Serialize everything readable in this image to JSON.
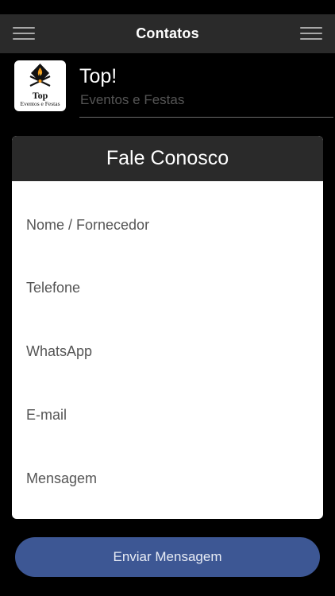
{
  "navbar": {
    "title": "Contatos",
    "left_icon": "hamburger-menu-icon",
    "right_icon": "hamburger-menu-icon"
  },
  "brand": {
    "logo_icon": "grill-flame-logo",
    "logo_top": "Top",
    "logo_sub": "Eventos e Festas",
    "name": "Top!",
    "tagline": "Eventos e Festas"
  },
  "form": {
    "title": "Fale Conosco",
    "fields": [
      {
        "placeholder": "Nome / Fornecedor"
      },
      {
        "placeholder": "Telefone"
      },
      {
        "placeholder": "WhatsApp"
      },
      {
        "placeholder": "E-mail"
      },
      {
        "placeholder": "Mensagem"
      }
    ],
    "submit_label": "Enviar Mensagem"
  },
  "colors": {
    "background": "#000000",
    "bar": "#2a2a2a",
    "button": "#3d5794",
    "card": "#ffffff"
  }
}
